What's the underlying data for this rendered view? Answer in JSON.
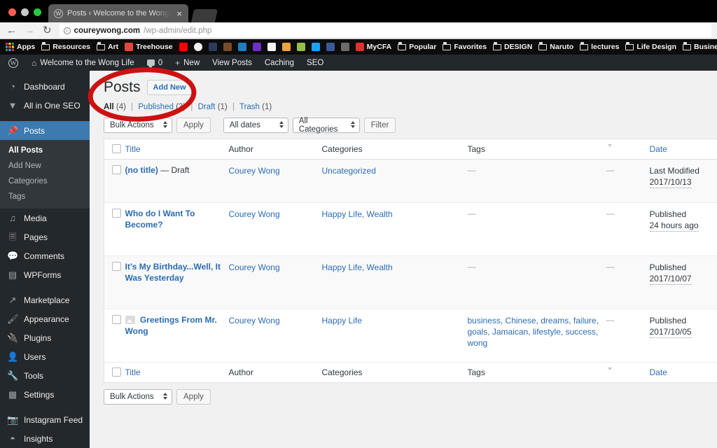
{
  "browser": {
    "tab": {
      "title": "Posts ‹ Welcome to the Wong Life",
      "favicon": "wordpress-favicon",
      "close_label": "×"
    },
    "nav": {
      "back": "←",
      "forward": "→",
      "reload": "↻"
    },
    "url": {
      "security_icon": "ⓘ",
      "host": "coureywong.com",
      "path": "/wp-admin/edit.php"
    },
    "bookmarks": [
      {
        "label": "Apps",
        "icon": "apps-grid-icon"
      },
      {
        "label": "Resources",
        "icon": "folder-icon"
      },
      {
        "label": "Art",
        "icon": "folder-icon"
      },
      {
        "label": "Treehouse",
        "icon": "treehouse-icon",
        "color": "#e8453c"
      },
      {
        "label": "",
        "icon": "youtube-icon",
        "color": "#ff0000"
      },
      {
        "label": "",
        "icon": "google-icon",
        "color": "#f2f2f2"
      },
      {
        "label": "",
        "icon": "evernote-icon",
        "color": "#2b3a5c"
      },
      {
        "label": "",
        "icon": "book-icon",
        "color": "#7a4b2a"
      },
      {
        "label": "",
        "icon": "tree-icon",
        "color": "#1d7ec4"
      },
      {
        "label": "",
        "icon": "mail-icon",
        "color": "#6e2fc6"
      },
      {
        "label": "",
        "icon": "amazon-icon",
        "color": "#f4f4f4"
      },
      {
        "label": "",
        "icon": "analytics-icon",
        "color": "#f2a33c"
      },
      {
        "label": "",
        "icon": "shopify-icon",
        "color": "#95bf47"
      },
      {
        "label": "",
        "icon": "twitter-icon",
        "color": "#1da1f2"
      },
      {
        "label": "",
        "icon": "facebook-icon",
        "color": "#3b5998"
      },
      {
        "label": "",
        "icon": "shield-icon",
        "color": "#6b6b6b"
      },
      {
        "label": "MyCFA",
        "icon": "mycfa-icon",
        "color": "#e03030"
      },
      {
        "label": "Popular",
        "icon": "folder-icon"
      },
      {
        "label": "Favorites",
        "icon": "folder-icon"
      },
      {
        "label": "DESIGN",
        "icon": "folder-icon"
      },
      {
        "label": "Naruto",
        "icon": "folder-icon"
      },
      {
        "label": "lectures",
        "icon": "folder-icon"
      },
      {
        "label": "Life Design",
        "icon": "folder-icon"
      },
      {
        "label": "Business",
        "icon": "folder-icon"
      }
    ]
  },
  "adminbar": {
    "logo": "wordpress-logo",
    "site_name": "Welcome to the Wong Life",
    "comment_count": "0",
    "new_label": "New",
    "view_posts_label": "View Posts",
    "caching_label": "Caching",
    "seo_label": "SEO"
  },
  "sidebar": {
    "items": [
      {
        "label": "Dashboard",
        "icon": "dashboard-icon",
        "glyph": "◔"
      },
      {
        "label": "All in One SEO",
        "icon": "shield-icon",
        "glyph": "▼"
      },
      {
        "label": "Posts",
        "icon": "pin-icon",
        "glyph": "✔",
        "active": true
      },
      {
        "label": "Media",
        "icon": "media-icon",
        "glyph": "♪"
      },
      {
        "label": "Pages",
        "icon": "pages-icon",
        "glyph": "❐"
      },
      {
        "label": "Comments",
        "icon": "comments-icon",
        "glyph": "▬"
      },
      {
        "label": "WPForms",
        "icon": "wpforms-icon",
        "glyph": "▤"
      },
      {
        "label": "Marketplace",
        "icon": "marketplace-icon",
        "glyph": "↗"
      },
      {
        "label": "Appearance",
        "icon": "appearance-icon",
        "glyph": "✒"
      },
      {
        "label": "Plugins",
        "icon": "plugins-icon",
        "glyph": "⚒"
      },
      {
        "label": "Users",
        "icon": "users-icon",
        "glyph": "●"
      },
      {
        "label": "Tools",
        "icon": "tools-icon",
        "glyph": "⚙"
      },
      {
        "label": "Settings",
        "icon": "settings-icon",
        "glyph": "▦"
      },
      {
        "label": "Instagram Feed",
        "icon": "camera-icon",
        "glyph": "▣"
      },
      {
        "label": "Insights",
        "icon": "insights-icon",
        "glyph": "◓"
      }
    ],
    "posts_submenu": [
      {
        "label": "All Posts",
        "current": true
      },
      {
        "label": "Add New",
        "current": false
      },
      {
        "label": "Categories",
        "current": false
      },
      {
        "label": "Tags",
        "current": false
      }
    ]
  },
  "page": {
    "title": "Posts",
    "add_new_label": "Add New",
    "views": [
      {
        "label": "All",
        "count": "(4)",
        "current": true
      },
      {
        "label": "Published",
        "count": "(3)",
        "current": false
      },
      {
        "label": "Draft",
        "count": "(1)",
        "current": false
      },
      {
        "label": "Trash",
        "count": "(1)",
        "current": false
      }
    ],
    "separator": "|",
    "toolbar": {
      "bulk_actions": "Bulk Actions",
      "apply_label": "Apply",
      "all_dates": "All dates",
      "all_categories": "All Categories",
      "filter_label": "Filter"
    },
    "toolbar_bottom": {
      "bulk_actions": "Bulk Actions",
      "apply_label": "Apply"
    },
    "columns": {
      "title": "Title",
      "author": "Author",
      "categories": "Categories",
      "tags": "Tags",
      "comments": "comments-bubble-icon",
      "date": "Date"
    },
    "rows": [
      {
        "title": "(no title)",
        "state": "— Draft",
        "has_thumb": false,
        "author": "Courey Wong",
        "categories": "Uncategorized",
        "tags": "—",
        "comments": "—",
        "date_state": "Last Modified",
        "date_value": "2017/10/13"
      },
      {
        "title": "Who do I Want To Become?",
        "state": "",
        "has_thumb": false,
        "author": "Courey Wong",
        "categories": "Happy Life, Wealth",
        "tags": "—",
        "comments": "—",
        "date_state": "Published",
        "date_value": "24 hours ago"
      },
      {
        "title": "It’s My Birthday...Well, It Was Yesterday",
        "state": "",
        "has_thumb": false,
        "author": "Courey Wong",
        "categories": "Happy Life, Wealth",
        "tags": "—",
        "comments": "—",
        "date_state": "Published",
        "date_value": "2017/10/07"
      },
      {
        "title": "Greetings From Mr. Wong",
        "state": "",
        "has_thumb": true,
        "author": "Courey Wong",
        "categories": "Happy Life",
        "tags": "business, Chinese, dreams, failure, goals, Jamaican, lifestyle, success, wong",
        "comments": "—",
        "date_state": "Published",
        "date_value": "2017/10/05"
      }
    ]
  },
  "annotation": {
    "shape": "red-ellipse-highlight",
    "color": "#cc1111",
    "target": "Posts / Add New heading"
  },
  "colors": {
    "admin_bg": "#23282d",
    "admin_submenu_bg": "#32373c",
    "active_menu": "#3c7ab0",
    "content_bg": "#f1f1f1",
    "link": "#2b6cb3",
    "annotation_red": "#cc1111"
  }
}
